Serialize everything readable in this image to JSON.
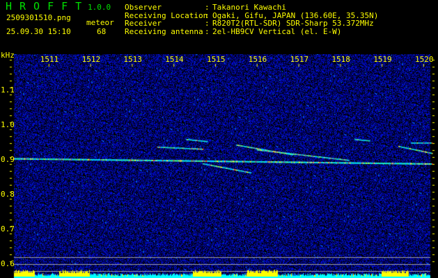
{
  "header": {
    "app_name": "HROFFT",
    "version": "1.0.0",
    "filename": "2509301510.png",
    "datetime": "25.09.30 15:10",
    "count_label": "meteor",
    "count_value": "68",
    "info": [
      {
        "label": "Observer",
        "sep": ":",
        "value": "Takanori Kawachi"
      },
      {
        "label": "Receiving Location",
        "sep": ":",
        "value": "Ogaki, Gifu, JAPAN (136.60E, 35.35N)"
      },
      {
        "label": "Receiver",
        "sep": ":",
        "value": "R820T2(RTL-SDR) SDR-Sharp 53.372MHz"
      },
      {
        "label": "Receiving antenna",
        "sep": ":",
        "value": "2el-HB9CV Vertical (el. E-W)"
      }
    ]
  },
  "chart_data": {
    "type": "heatmap",
    "ylabel": "kHz",
    "x_ticks": [
      "1511",
      "1512",
      "1513",
      "1514",
      "1515",
      "1516",
      "1517",
      "1518",
      "1519",
      "1520"
    ],
    "y_ticks": [
      "1.1",
      "1.0",
      "0.9",
      "0.8",
      "0.7",
      "0.6"
    ],
    "xlim": [
      1510,
      1520.2
    ],
    "ylim": [
      0.57,
      1.2
    ],
    "colors": {
      "background": "#000000",
      "noise": "#1010c0",
      "signal_low": "#00ffff",
      "signal_high": "#ff3030",
      "text": "#ffff00",
      "histogram_low": "#00ffff",
      "histogram_high": "#ffff00",
      "guide_line": "#a0a0a0"
    },
    "carrier": {
      "freq_start": 0.905,
      "freq_end": 0.89
    },
    "meteor_echoes": [
      {
        "t": [
          1513.6,
          1514.7
        ],
        "f": [
          0.938,
          0.932
        ]
      },
      {
        "t": [
          1514.3,
          1514.8
        ],
        "f": [
          0.96,
          0.954
        ]
      },
      {
        "t": [
          1514.7,
          1515.85
        ],
        "f": [
          0.89,
          0.864
        ]
      },
      {
        "t": [
          1515.5,
          1516.85
        ],
        "f": [
          0.944,
          0.916
        ]
      },
      {
        "t": [
          1516.0,
          1518.2
        ],
        "f": [
          0.93,
          0.9
        ]
      },
      {
        "t": [
          1518.35,
          1518.7
        ],
        "f": [
          0.96,
          0.956
        ]
      },
      {
        "t": [
          1519.4,
          1520.2
        ],
        "f": [
          0.94,
          0.92
        ]
      },
      {
        "t": [
          1519.7,
          1520.2
        ],
        "f": [
          0.95,
          0.95
        ]
      }
    ]
  }
}
